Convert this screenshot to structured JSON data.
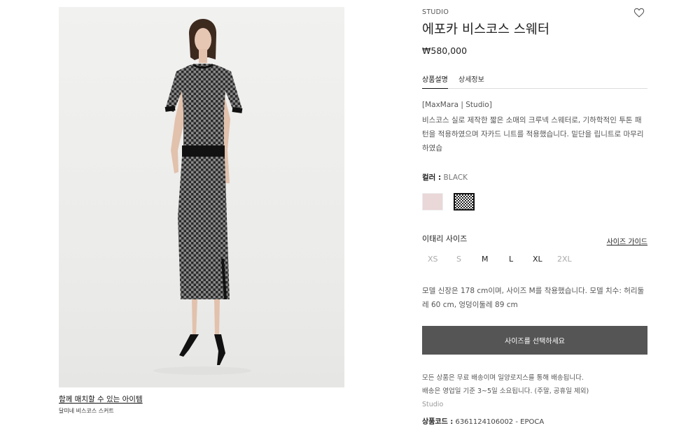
{
  "product": {
    "brand": "STUDIO",
    "name": "에포카 비스코스 스웨터",
    "price": "₩580,000",
    "image_icon": "product-photo"
  },
  "tabs": [
    {
      "label": "상품설명",
      "active": true
    },
    {
      "label": "상세정보",
      "active": false
    }
  ],
  "description": {
    "brand_line": "[MaxMara | Studio]",
    "text": "비스코스 실로 제작한 짧은 소매의 크루넥 스웨터로, 기하학적인 투톤 패턴을 적용하였으며 자카드 니트를 적용했습니다. 밑단을 립니트로 마무리하였습"
  },
  "color": {
    "label": "컬러 :",
    "value": "BLACK",
    "swatches": [
      {
        "name": "pink",
        "color": "#ead7d8"
      },
      {
        "name": "black",
        "color": "#222222",
        "selected": true
      }
    ]
  },
  "size": {
    "title": "이태리 사이즈",
    "guide_label": "사이즈 가이드",
    "options": [
      "XS",
      "S",
      "M",
      "L",
      "XL",
      "2XL"
    ],
    "available": [
      false,
      false,
      true,
      true,
      true,
      false
    ]
  },
  "model_info": "모델 신장은 178 cm이며, 사이즈 M를 착용했습니다. 모델 치수: 허리둘레 60 cm, 엉덩이둘레 89 cm",
  "select_button": "사이즈를 선택하세요",
  "shipping": {
    "line1": "모든 상품은 무료 배송이며 일양로지스를 통해 배송됩니다.",
    "line2": "배송은 영업일 기준 3~5일 소요됩니다. (주말, 공휴일 제외)"
  },
  "studio_label": "Studio",
  "product_code": {
    "label": "상품코드 :",
    "value": " 6361124106002 - EPOCA"
  },
  "match": {
    "title": "함께 매치할 수 있는 아이템",
    "item": "달미네 비스코스 스커트"
  }
}
